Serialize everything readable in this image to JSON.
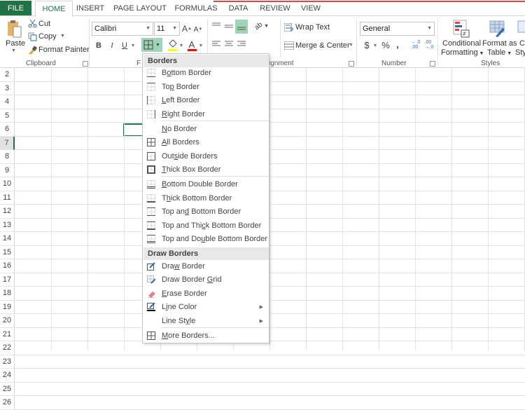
{
  "tabs": [
    {
      "label": "FILE",
      "active": false
    },
    {
      "label": "HOME",
      "active": true
    },
    {
      "label": "INSERT",
      "active": false
    },
    {
      "label": "PAGE LAYOUT",
      "active": false
    },
    {
      "label": "FORMULAS",
      "active": false
    },
    {
      "label": "DATA",
      "active": false
    },
    {
      "label": "REVIEW",
      "active": false
    },
    {
      "label": "VIEW",
      "active": false
    }
  ],
  "clipboard": {
    "paste": "Paste",
    "cut": "Cut",
    "copy": "Copy",
    "format_painter": "Format Painter",
    "group_label": "Clipboard"
  },
  "font": {
    "name": "Calibri",
    "size": "11",
    "bold": "B",
    "italic": "I",
    "underline": "U",
    "group_label_partial": "F"
  },
  "alignment": {
    "wrap_text": "Wrap Text",
    "merge_center": "Merge & Center",
    "group_label_partial": "ignment"
  },
  "number": {
    "format": "General",
    "currency": "$",
    "percent": "%",
    "comma": ",",
    "group_label": "Number"
  },
  "styles": {
    "conditional_formatting_1": "Conditional",
    "conditional_formatting_2": "Formatting",
    "format_as_table_1": "Format as",
    "format_as_table_2": "Table",
    "cell_styles_1": "C",
    "cell_styles_2": "Styl",
    "group_label": "Styles"
  },
  "grid": {
    "rows": [
      "2",
      "3",
      "4",
      "5",
      "6",
      "7",
      "8",
      "9",
      "10",
      "11",
      "12",
      "13",
      "14",
      "15",
      "16",
      "17",
      "18",
      "19",
      "20",
      "21",
      "22",
      "23",
      "24",
      "25",
      "26"
    ],
    "selected_row": "7"
  },
  "borders_menu": {
    "header1": "Borders",
    "header2": "Draw Borders",
    "items": [
      {
        "pre": "B",
        "u": "o",
        "post": "ttom Border",
        "icon": "bottom-border-icon"
      },
      {
        "pre": "To",
        "u": "p",
        "post": " Border",
        "icon": "top-border-icon"
      },
      {
        "pre": "",
        "u": "L",
        "post": "eft Border",
        "icon": "left-border-icon"
      },
      {
        "pre": "",
        "u": "R",
        "post": "ight Border",
        "icon": "right-border-icon"
      },
      {
        "pre": "",
        "u": "N",
        "post": "o Border",
        "icon": "no-border-icon"
      },
      {
        "pre": "",
        "u": "A",
        "post": "ll Borders",
        "icon": "all-borders-icon"
      },
      {
        "pre": "Out",
        "u": "s",
        "post": "ide Borders",
        "icon": "outside-borders-icon"
      },
      {
        "pre": "",
        "u": "T",
        "post": "hick Box Border",
        "icon": "thick-box-border-icon"
      },
      {
        "pre": "",
        "u": "B",
        "post": "ottom Double Border",
        "icon": "bottom-double-border-icon"
      },
      {
        "pre": "T",
        "u": "h",
        "post": "ick Bottom Border",
        "icon": "thick-bottom-border-icon"
      },
      {
        "pre": "Top an",
        "u": "d",
        "post": " Bottom Border",
        "icon": "top-bottom-border-icon"
      },
      {
        "pre": "Top and Thi",
        "u": "c",
        "post": "k Bottom Border",
        "icon": "top-thick-bottom-border-icon"
      },
      {
        "pre": "Top and Do",
        "u": "u",
        "post": "ble Bottom Border",
        "icon": "top-double-bottom-border-icon"
      },
      {
        "pre": "Dra",
        "u": "w",
        "post": " Border",
        "icon": "draw-border-icon"
      },
      {
        "pre": "Draw Border ",
        "u": "G",
        "post": "rid",
        "icon": "draw-border-grid-icon"
      },
      {
        "pre": "",
        "u": "E",
        "post": "rase Border",
        "icon": "eraser-icon"
      },
      {
        "pre": "L",
        "u": "i",
        "post": "ne Color",
        "icon": "line-color-icon",
        "submenu": true
      },
      {
        "pre": "Line St",
        "u": "y",
        "post": "le",
        "icon": "",
        "submenu": true
      },
      {
        "pre": "",
        "u": "M",
        "post": "ore Borders...",
        "icon": "more-borders-icon"
      }
    ]
  },
  "colors": {
    "accent": "#217346",
    "highlight": "#9fd5b7",
    "fill_color": "#ffff00",
    "font_color": "#ff0000"
  }
}
